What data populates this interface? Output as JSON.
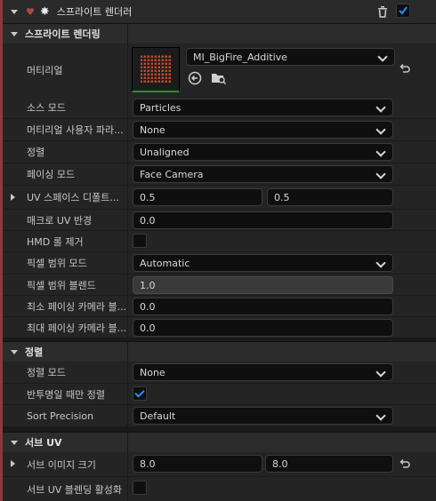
{
  "header": {
    "title": "스프라이트 렌더러",
    "enabled": true
  },
  "sections": {
    "sprite_rendering": "스프라이트 렌더링",
    "alignment": "정렬",
    "sub_uv": "서브 UV"
  },
  "material": {
    "label": "머티리얼",
    "value": "MI_BigFire_Additive"
  },
  "rows": {
    "source_mode": {
      "label": "소스 모드",
      "value": "Particles"
    },
    "material_param": {
      "label": "머티리얼 사용자 파라...",
      "value": "None"
    },
    "alignment": {
      "label": "정렬",
      "value": "Unaligned"
    },
    "facing_mode": {
      "label": "페이싱 모드",
      "value": "Face Camera"
    },
    "uv_scale": {
      "label": "UV 스페이스 디폴트...",
      "x": "0.5",
      "y": "0.5"
    },
    "macro_uv": {
      "label": "매크로 UV 반경",
      "value": "0.0"
    },
    "hmd_roll": {
      "label": "HMD 롤 제거",
      "checked": false
    },
    "pixel_coverage_mode": {
      "label": "픽셀 범위 모드",
      "value": "Automatic"
    },
    "pixel_coverage_blend": {
      "label": "픽셀 범위 블렌드",
      "value": "1.0"
    },
    "min_facing": {
      "label": "최소 페이싱 카메라 블...",
      "value": "0.0"
    },
    "max_facing": {
      "label": "최대 페이싱 카메라 블...",
      "value": "0.0"
    },
    "alignment_mode": {
      "label": "정렬 모드",
      "value": "None"
    },
    "sort_translucent": {
      "label": "반투명일 때만 정렬",
      "checked": true
    },
    "sort_precision": {
      "label": "Sort Precision",
      "value": "Default"
    },
    "sub_image_size": {
      "label": "서브 이미지 크기",
      "x": "8.0",
      "y": "8.0"
    },
    "sub_uv_blend": {
      "label": "서브 UV 블렌딩 활성화",
      "checked": false
    }
  },
  "colors": {
    "accent": "#8a3a3a",
    "checkbox": "#2a8cff"
  }
}
